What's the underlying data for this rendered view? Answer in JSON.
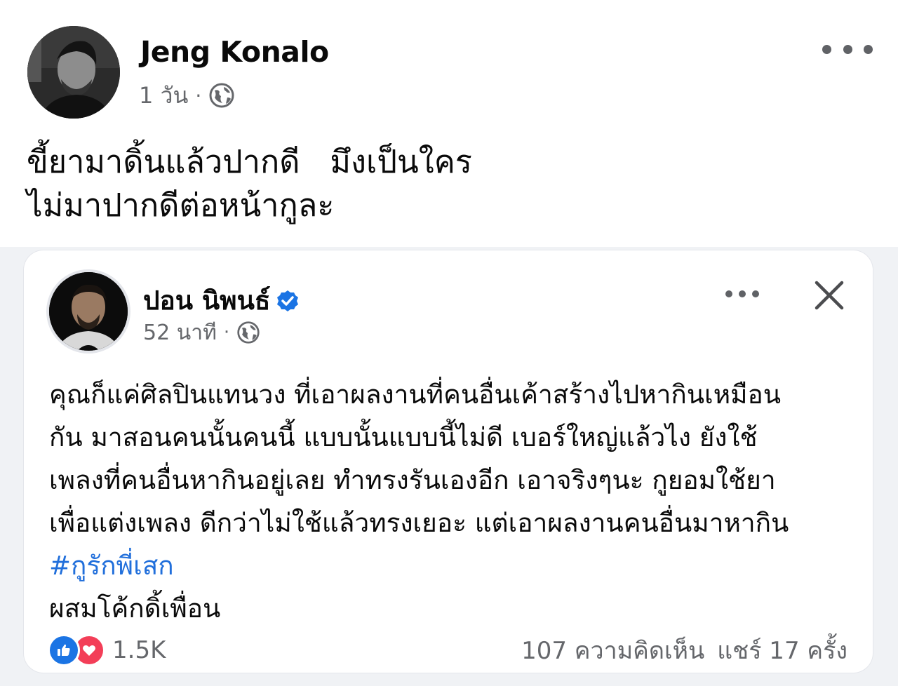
{
  "post": {
    "author": "Jeng Konalo",
    "time": "1 วัน",
    "separator": "·",
    "text_lines": [
      "ขี้ยามาดิ้นแล้วปากดี   มึงเป็นใคร",
      "ไม่มาปากดีต่อหน้ากูละ"
    ]
  },
  "shared_post": {
    "author": "ปอน นิพนธ์",
    "time": "52 นาที",
    "separator": "·",
    "text_lines": [
      "คุณก็แค่ศิลปินแทนวง ที่เอาผลงานที่คนอื่นเค้าสร้างไปหากินเหมือน",
      "กัน มาสอนคนนั้นคนนี้ แบบนั้นแบบนี้ไม่ดี เบอร์ใหญ่แล้วไง ยังใช้",
      "เพลงที่คนอื่นหากินอยู่เลย ทำทรงรันเองอีก เอาจริงๆนะ กูยอมใช้ยา",
      "เพื่อแต่งเพลง ดีกว่าไม่ใช้แล้วทรงเยอะ แต่เอาผลงานคนอื่นมาหากิน"
    ],
    "hashtag": "#กูรักพี่เสก",
    "last_line": "ผสมโค้กดิ้เพื่อน",
    "reaction_count": "1.5K",
    "comments": "107 ความคิดเห็น",
    "shares": "แชร์ 17 ครั้ง"
  },
  "icons": {
    "privacy": "globe-icon",
    "verified": "verified-badge-icon",
    "more": "more-options-icon",
    "close": "close-icon",
    "like": "like-reaction-icon",
    "love": "love-reaction-icon"
  },
  "colors": {
    "accent": "#1b74e4",
    "hashtag": "#216fdb",
    "love": "#f33e58",
    "meta_gray": "#65676b"
  }
}
